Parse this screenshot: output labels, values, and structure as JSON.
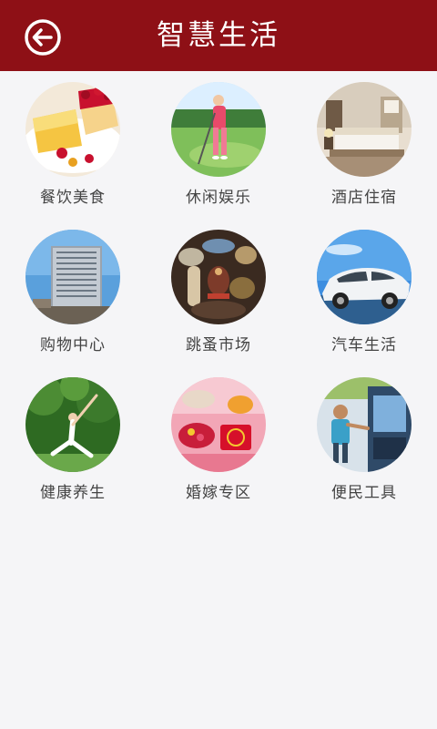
{
  "header": {
    "title": "智慧生活",
    "back_icon": "back-arrow-icon",
    "bg_color": "#8e1016"
  },
  "categories": [
    {
      "label": "餐饮美食",
      "icon": "food-image"
    },
    {
      "label": "休闲娱乐",
      "icon": "golf-image"
    },
    {
      "label": "酒店住宿",
      "icon": "hotel-image"
    },
    {
      "label": "购物中心",
      "icon": "mall-image"
    },
    {
      "label": "跳蚤市场",
      "icon": "flea-market-image"
    },
    {
      "label": "汽车生活",
      "icon": "car-image"
    },
    {
      "label": "健康养生",
      "icon": "yoga-image"
    },
    {
      "label": "婚嫁专区",
      "icon": "wedding-image"
    },
    {
      "label": "便民工具",
      "icon": "convenience-image"
    }
  ]
}
